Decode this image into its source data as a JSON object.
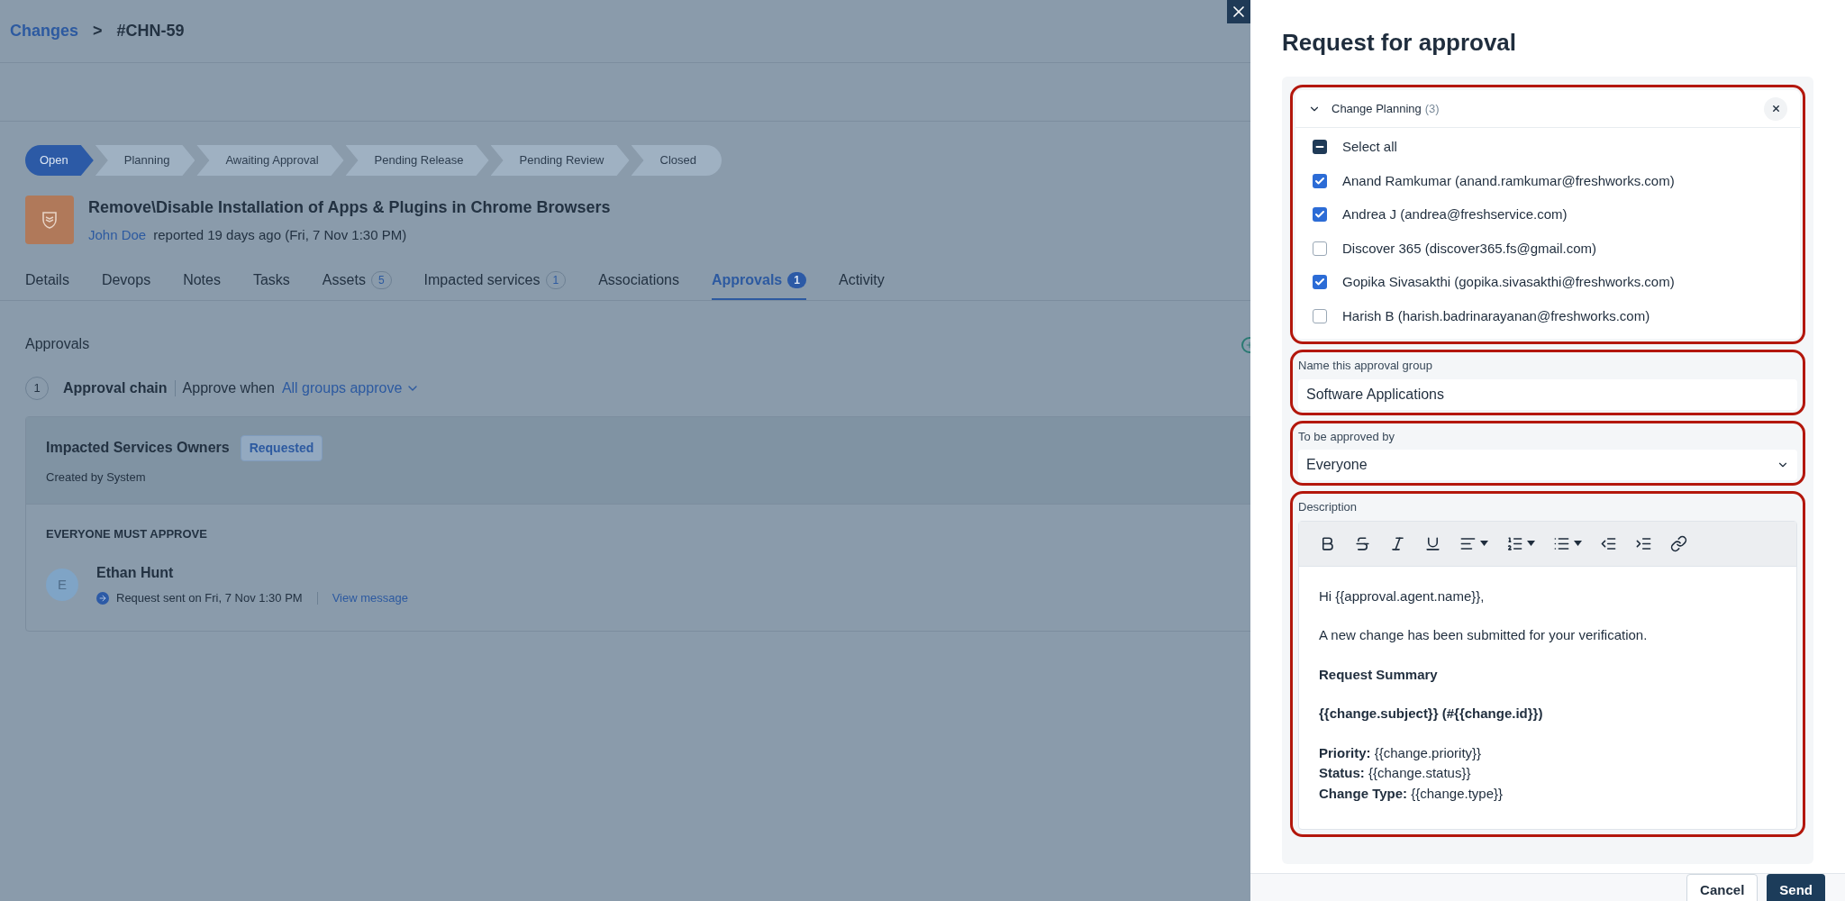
{
  "breadcrumb": {
    "parent": "Changes",
    "separator": ">",
    "current": "#CHN-59"
  },
  "stages": [
    {
      "label": "Open",
      "selected": true
    },
    {
      "label": "Planning",
      "selected": false
    },
    {
      "label": "Awaiting Approval",
      "selected": false
    },
    {
      "label": "Pending Release",
      "selected": false
    },
    {
      "label": "Pending Review",
      "selected": false
    },
    {
      "label": "Closed",
      "selected": false
    }
  ],
  "change": {
    "title": "Remove\\Disable Installation of Apps & Plugins in Chrome Browsers",
    "requester": "John Doe",
    "reported": "reported 19 days ago (Fri, 7 Nov 1:30 PM)"
  },
  "tabs": [
    {
      "label": "Details",
      "selected": false
    },
    {
      "label": "Devops",
      "selected": false
    },
    {
      "label": "Notes",
      "selected": false
    },
    {
      "label": "Tasks",
      "selected": false
    },
    {
      "label": "Assets",
      "count": "5",
      "selected": false
    },
    {
      "label": "Impacted services",
      "count": "1",
      "selected": false
    },
    {
      "label": "Associations",
      "selected": false
    },
    {
      "label": "Approvals",
      "count": "1",
      "selected": true
    },
    {
      "label": "Activity",
      "selected": false
    }
  ],
  "approvals": {
    "heading": "Approvals",
    "chain_number": "1",
    "chain_label": "Approval chain",
    "approve_when": "Approve when",
    "rule": "All groups approve",
    "group": {
      "name": "Impacted Services Owners",
      "status": "Requested",
      "created_by": "Created by System",
      "policy": "EVERYONE MUST APPROVE",
      "approver": {
        "initial": "E",
        "name": "Ethan Hunt",
        "sent": "Request sent on Fri, 7 Nov 1:30 PM",
        "link": "View message"
      }
    }
  },
  "panel": {
    "title": "Request for approval",
    "group_header": {
      "name": "Change Planning",
      "count": "(3)",
      "expanded": true
    },
    "select_all": {
      "label": "Select all",
      "indeterminate": true
    },
    "members": [
      {
        "label": "Anand Ramkumar (anand.ramkumar@freshworks.com)",
        "checked": true
      },
      {
        "label": "Andrea J (andrea@freshservice.com)",
        "checked": true
      },
      {
        "label": "Discover 365 (discover365.fs@gmail.com)",
        "checked": false
      },
      {
        "label": "Gopika Sivasakthi (gopika.sivasakthi@freshworks.com)",
        "checked": true
      },
      {
        "label": "Harish B (harish.badrinarayanan@freshworks.com)",
        "checked": false
      }
    ],
    "name_field": {
      "label": "Name this approval group",
      "value": "Software Applications"
    },
    "approved_by": {
      "label": "To be approved by",
      "value": "Everyone"
    },
    "description": {
      "label": "Description",
      "paragraphs": [
        {
          "lines": [
            "Hi {{approval.agent.name}},"
          ],
          "bold": false
        },
        {
          "lines": [
            "A new change has been submitted for your verification."
          ],
          "bold": false
        },
        {
          "lines": [
            "Request Summary"
          ],
          "bold": true
        },
        {
          "lines": [
            "{{change.subject}} (#{{change.id}})"
          ],
          "bold": true
        },
        {
          "lines": [
            "**Priority:** {{change.priority}}",
            "**Status:** {{change.status}}",
            "**Change Type:** {{change.type}}"
          ],
          "bold": false
        }
      ]
    },
    "buttons": [
      {
        "label": "Cancel",
        "kind": "secondary"
      },
      {
        "label": "Send",
        "kind": "primary"
      }
    ]
  }
}
